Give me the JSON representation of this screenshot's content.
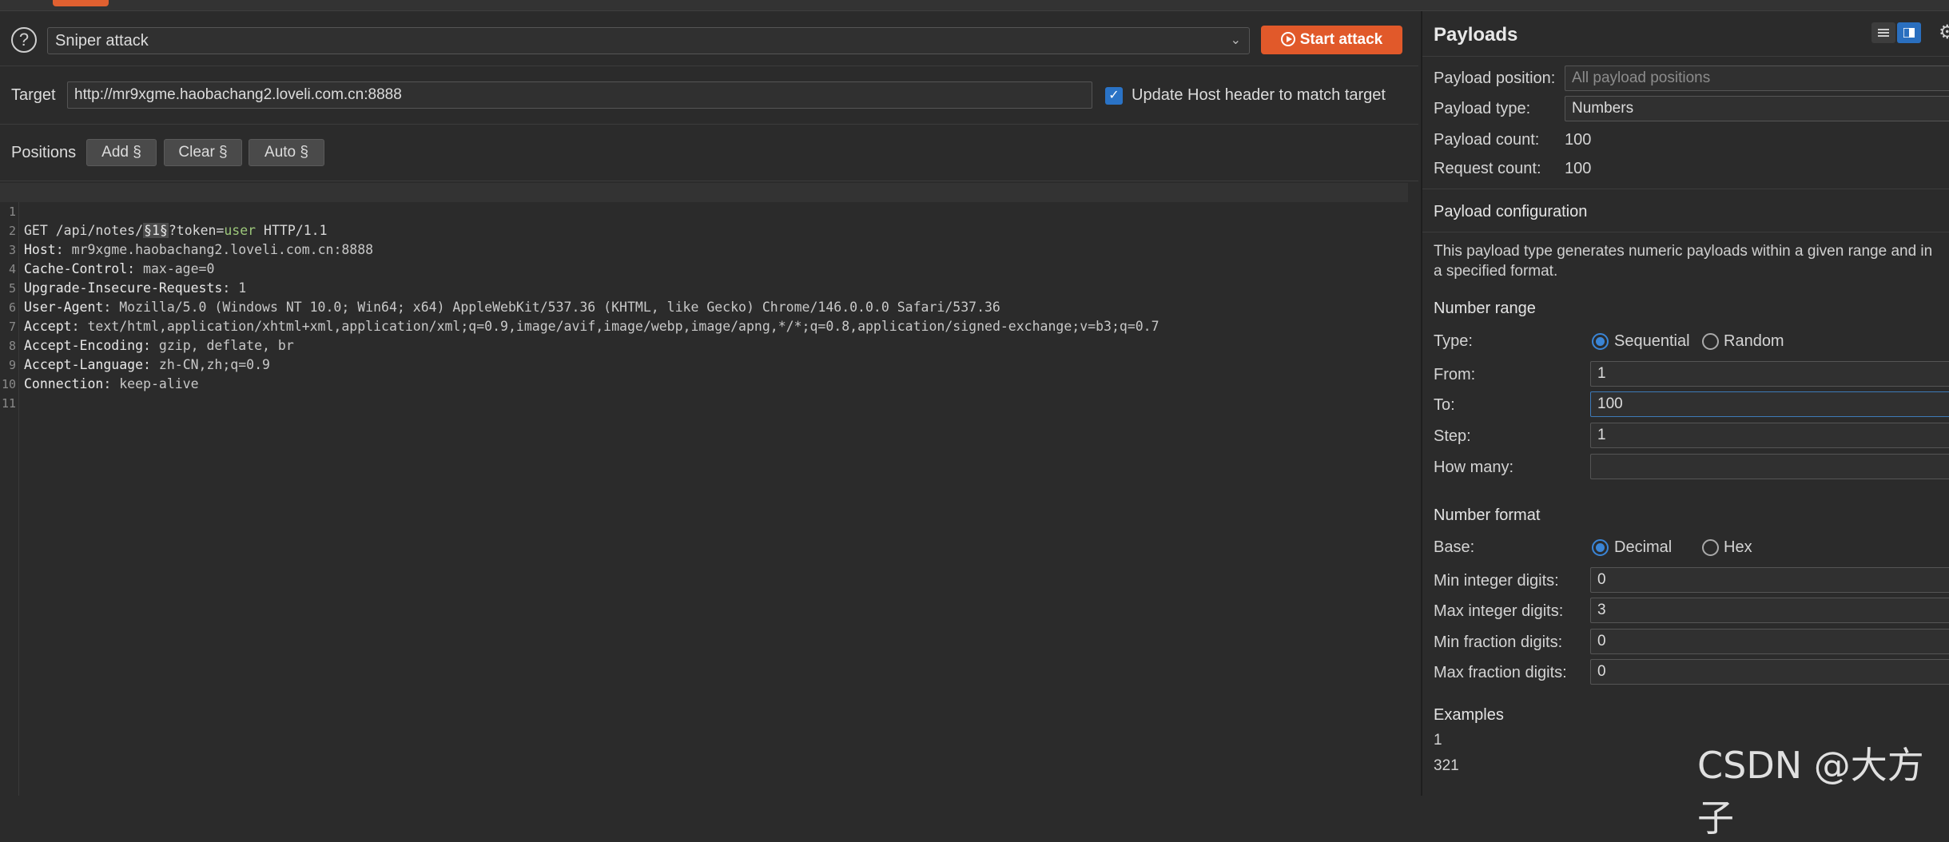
{
  "attack": {
    "type": "Sniper attack",
    "start_label": "Start attack"
  },
  "target": {
    "label": "Target",
    "url": "http://mr9xgme.haobachang2.loveli.com.cn:8888",
    "update_host_label": "Update Host header to match target",
    "update_host_checked": true
  },
  "positions": {
    "label": "Positions",
    "add": "Add §",
    "clear": "Clear §",
    "auto": "Auto §"
  },
  "request": {
    "lines": [
      {
        "num": "1",
        "before": "GET /api/notes/",
        "marker": "§1§",
        "after_green_prefix": "?token=",
        "green": "user",
        "after": " HTTP/1.1"
      },
      {
        "num": "2",
        "name": "Host",
        "value": " mr9xgme.haobachang2.loveli.com.cn:8888"
      },
      {
        "num": "3",
        "name": "Cache-Control",
        "value": " max-age=0"
      },
      {
        "num": "4",
        "name": "Upgrade-Insecure-Requests",
        "value": " 1"
      },
      {
        "num": "5",
        "name": "User-Agent",
        "value": " Mozilla/5.0 (Windows NT 10.0; Win64; x64) AppleWebKit/537.36 (KHTML, like Gecko) Chrome/146.0.0.0 Safari/537.36"
      },
      {
        "num": "6",
        "name": "Accept",
        "value": " text/html,application/xhtml+xml,application/xml;q=0.9,image/avif,image/webp,image/apng,*/*;q=0.8,application/signed-exchange;v=b3;q=0.7"
      },
      {
        "num": "7",
        "name": "Accept-Encoding",
        "value": " gzip, deflate, br"
      },
      {
        "num": "8",
        "name": "Accept-Language",
        "value": " zh-CN,zh;q=0.9"
      },
      {
        "num": "9",
        "name": "Connection",
        "value": " keep-alive"
      },
      {
        "num": "10"
      },
      {
        "num": "11"
      }
    ]
  },
  "payloads": {
    "title": "Payloads",
    "position_label": "Payload position:",
    "position_placeholder": "All payload positions",
    "type_label": "Payload type:",
    "type_value": "Numbers",
    "count_label": "Payload count:",
    "count_value": "100",
    "request_count_label": "Request count:",
    "request_count_value": "100",
    "config_title": "Payload configuration",
    "config_desc": "This payload type generates numeric payloads within a given range and in a specified format.",
    "number_range": {
      "title": "Number range",
      "type_label": "Type:",
      "sequential": "Sequential",
      "random": "Random",
      "selected": "Sequential",
      "from_label": "From:",
      "from_value": "1",
      "to_label": "To:",
      "to_value": "100",
      "step_label": "Step:",
      "step_value": "1",
      "how_many_label": "How many:",
      "how_many_value": ""
    },
    "number_format": {
      "title": "Number format",
      "base_label": "Base:",
      "decimal": "Decimal",
      "hex": "Hex",
      "selected": "Decimal",
      "min_int_label": "Min integer digits:",
      "min_int_value": "0",
      "max_int_label": "Max integer digits:",
      "max_int_value": "3",
      "min_frac_label": "Min fraction digits:",
      "min_frac_value": "0",
      "max_frac_label": "Max fraction digits:",
      "max_frac_value": "0"
    },
    "examples": {
      "title": "Examples",
      "values": [
        "1",
        "321"
      ]
    }
  },
  "watermark": "CSDN @大方子",
  "colors": {
    "accent": "#e1592a",
    "checkbox": "#2a73c6",
    "radio_on": "#3a85d6",
    "token_green": "#9cc77a"
  }
}
